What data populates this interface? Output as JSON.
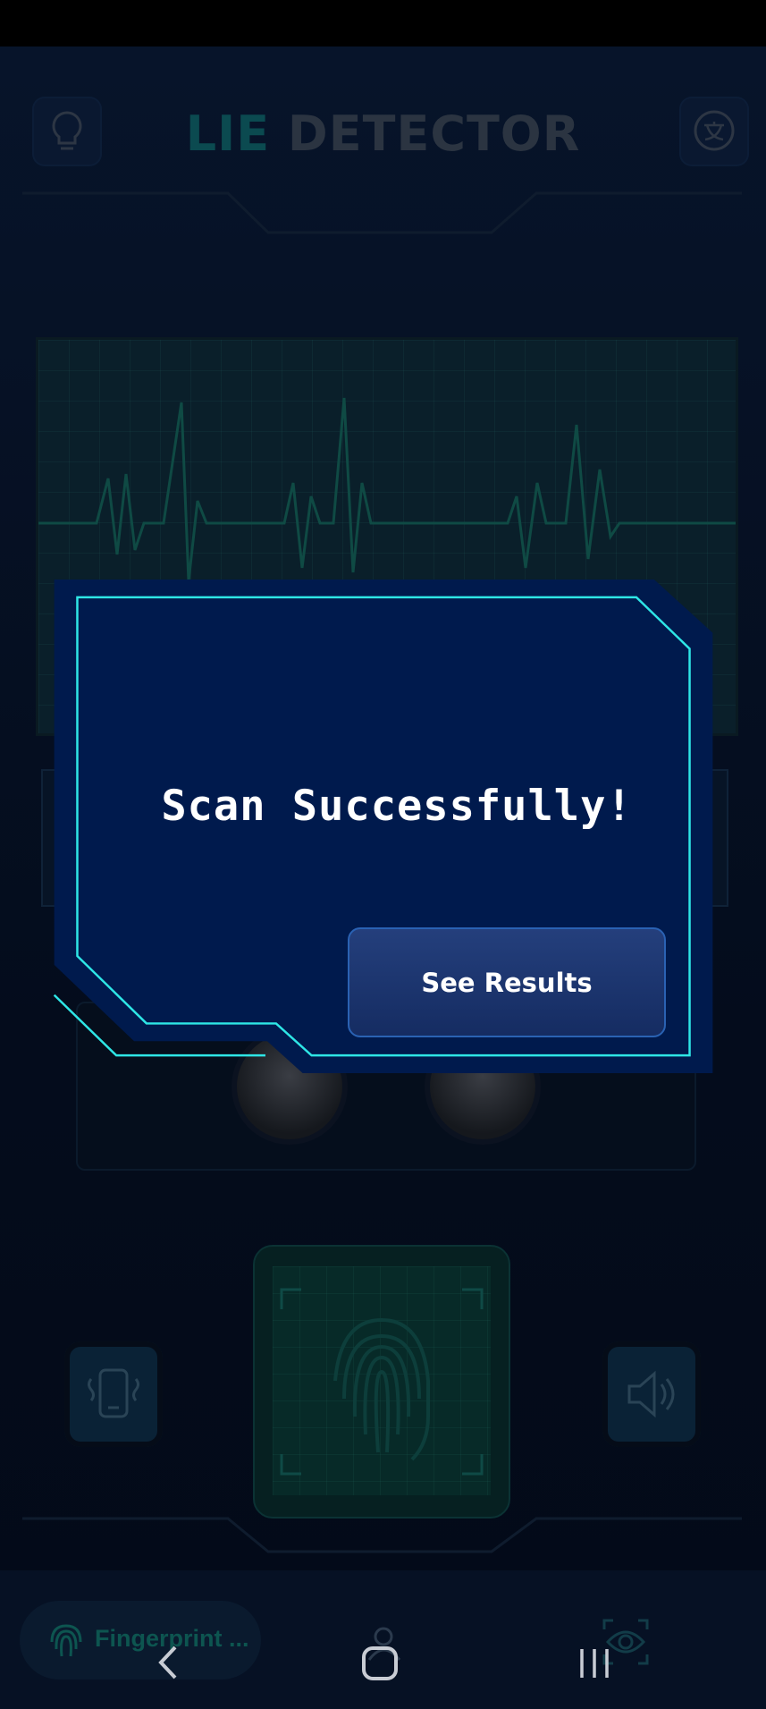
{
  "header": {
    "title_part1": "LIE",
    "title_part2": "DETECTOR",
    "left_icon": "lightbulb-icon",
    "right_icon": "translate-icon"
  },
  "dialog": {
    "message": "Scan Successfully!",
    "button_label": "See Results"
  },
  "bottom_tabs": {
    "fingerprint_label": "Fingerprint ...",
    "fingerprint_icon": "fingerprint-icon",
    "people_icon": "people-icon",
    "eye_icon": "eye-scan-icon"
  },
  "colors": {
    "accent_cyan": "#2ee6e6",
    "dialog_bg": "#001a4d",
    "button_bg": "#1d3670"
  }
}
